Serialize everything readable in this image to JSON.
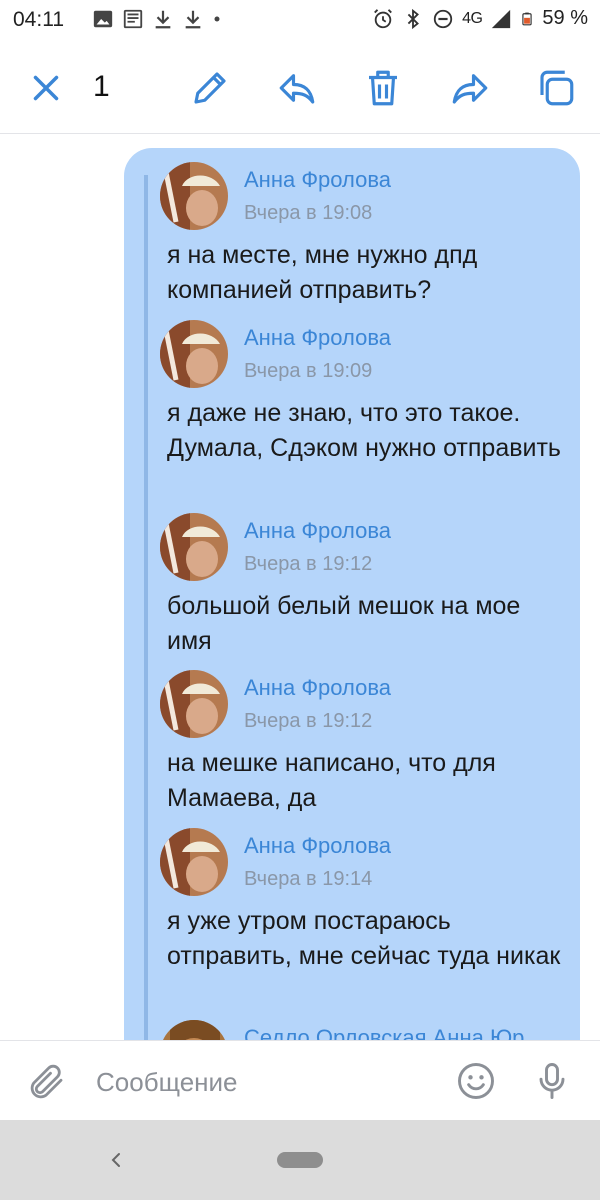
{
  "status_bar": {
    "time": "04:11",
    "network": "4G",
    "battery": "59 %"
  },
  "action_bar": {
    "selected_count": "1"
  },
  "messages": [
    {
      "author": "Анна Фролова",
      "date": "Вчера в 19:08",
      "text": "я на месте, мне нужно дпд компанией отправить?"
    },
    {
      "author": "Анна Фролова",
      "date": "Вчера в 19:09",
      "text": "я даже не знаю, что это такое. Думала, Сдэком нужно отправить"
    },
    {
      "author": "Анна Фролова",
      "date": "Вчера в 19:12",
      "text": "большой белый мешок на мое имя"
    },
    {
      "author": "Анна Фролова",
      "date": "Вчера в 19:12",
      "text": "на мешке написано, что для Мамаева, да"
    },
    {
      "author": "Анна Фролова",
      "date": "Вчера в 19:14",
      "text": "я уже утром постараюсь отправить, мне сейчас туда никак"
    },
    {
      "author": "Седло Орловская Анна Юр",
      "date": "",
      "text": ""
    }
  ],
  "input": {
    "placeholder": "Сообщение"
  },
  "colors": {
    "accent": "#3b86d6",
    "bubble": "#b5d5fa",
    "quote_bar": "#8fb7e6",
    "date_text": "#8a97a8"
  }
}
